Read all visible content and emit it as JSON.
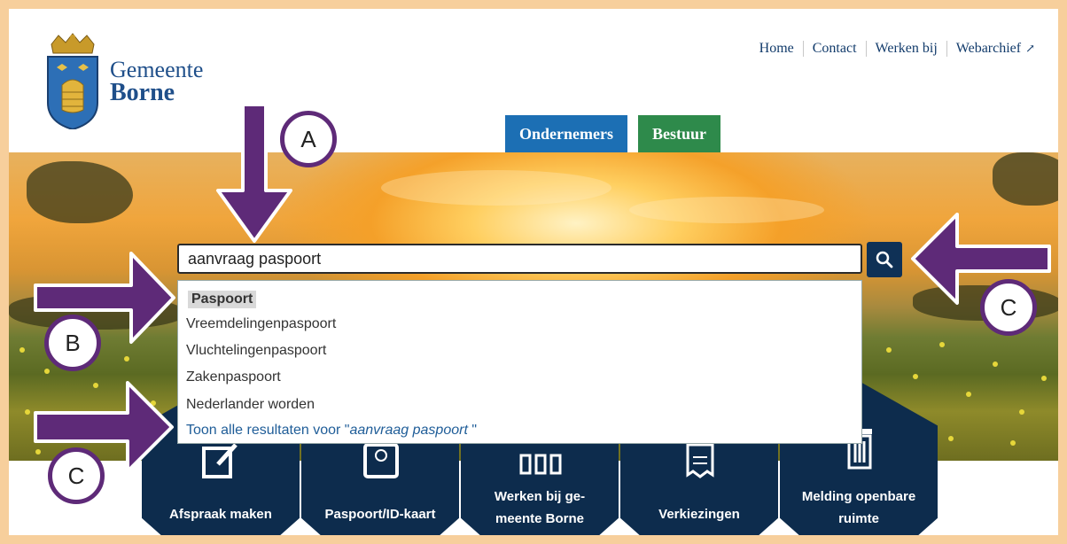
{
  "brand": {
    "line1": "Gemeente",
    "line2": "Borne"
  },
  "topnav": {
    "home": "Home",
    "contact": "Contact",
    "werken": "Werken bij",
    "webarchief": "Webarchief"
  },
  "tabs": {
    "ondernemers": "Ondernemers",
    "bestuur": "Bestuur"
  },
  "search": {
    "value": "aanvraag paspoort"
  },
  "suggestions": {
    "items": [
      "Paspoort",
      "Vreemdelingenpaspoort",
      "Vluchtelingenpaspoort",
      "Zakenpaspoort",
      "Nederlander worden"
    ],
    "all_prefix": "Toon alle resultaten voor \"",
    "all_query": "aanvraag paspoort",
    "all_suffix": " \""
  },
  "tiles": {
    "afspraak": "Afspraak maken",
    "paspoort": "Paspoort/ID-kaart",
    "werken_l1": "Werken bij ge-",
    "werken_l2": "meente Borne",
    "verkiezingen": "Verkiezingen",
    "melding_l1": "Melding openbare",
    "melding_l2": "ruimte"
  },
  "annotations": {
    "a": "A",
    "b": "B",
    "c_right": "C",
    "c_left": "C"
  },
  "colors": {
    "annotation": "#5e2a78",
    "navy": "#0d2c4d",
    "tab_blue": "#1c6fb4",
    "tab_green": "#2e8a4b",
    "frame": "#f7cf9c"
  }
}
